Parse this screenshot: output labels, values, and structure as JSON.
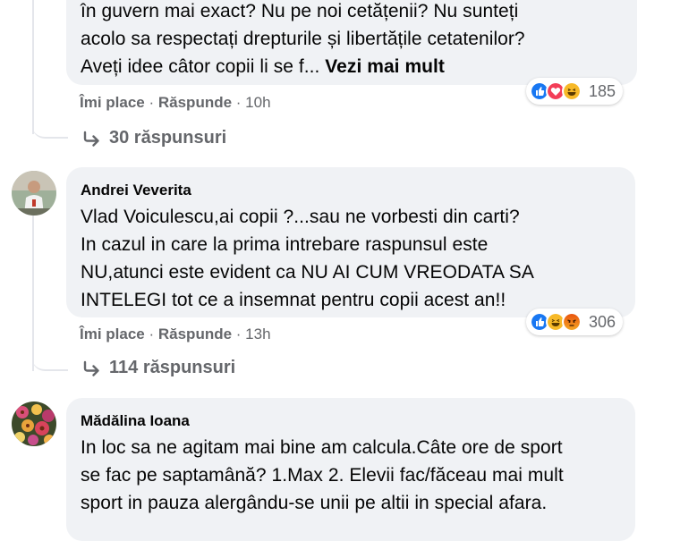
{
  "comments": [
    {
      "author": "",
      "lines": [
        "în guvern mai exact? Nu pe noi cetățenii? Nu sunteți",
        "acolo sa respectați drepturile și libertățile cetatenilor?",
        "Aveți idee câtor copii li se f... "
      ],
      "see_more": "Vezi mai mult",
      "like_label": "Îmi place",
      "reply_label": "Răspunde",
      "time": "10h",
      "reactions": [
        "like",
        "love",
        "haha"
      ],
      "reaction_count": "185",
      "replies_label": "30 răspunsuri"
    },
    {
      "author": "Andrei Veverita",
      "lines": [
        "Vlad Voiculescu,ai copii ?...sau ne vorbesti din carti?",
        "In cazul in care la prima intrebare raspunsul este",
        "NU,atunci este evident ca NU AI CUM VREODATA SA",
        "INTELEGI tot ce a insemnat pentru copii acest an!!"
      ],
      "like_label": "Îmi place",
      "reply_label": "Răspunde",
      "time": "13h",
      "reactions": [
        "like",
        "haha",
        "angry"
      ],
      "reaction_count": "306",
      "replies_label": "114 răspunsuri"
    },
    {
      "author": "Mădălina Ioana",
      "lines": [
        "In loc sa ne agitam mai bine am calcula.Câte ore de sport",
        "se fac pe saptamână? 1.Max 2. Elevii fac/făceau mai mult",
        "sport in pauza alergându-se unii pe altii in special afara."
      ]
    }
  ],
  "colors": {
    "bubble": "#f0f2f5",
    "secondary_text": "#65676b",
    "like_blue": "#1877f2",
    "love_red": "#f33e58",
    "haha_yellow": "#f7b928",
    "angry_orange": "#e9710f"
  }
}
